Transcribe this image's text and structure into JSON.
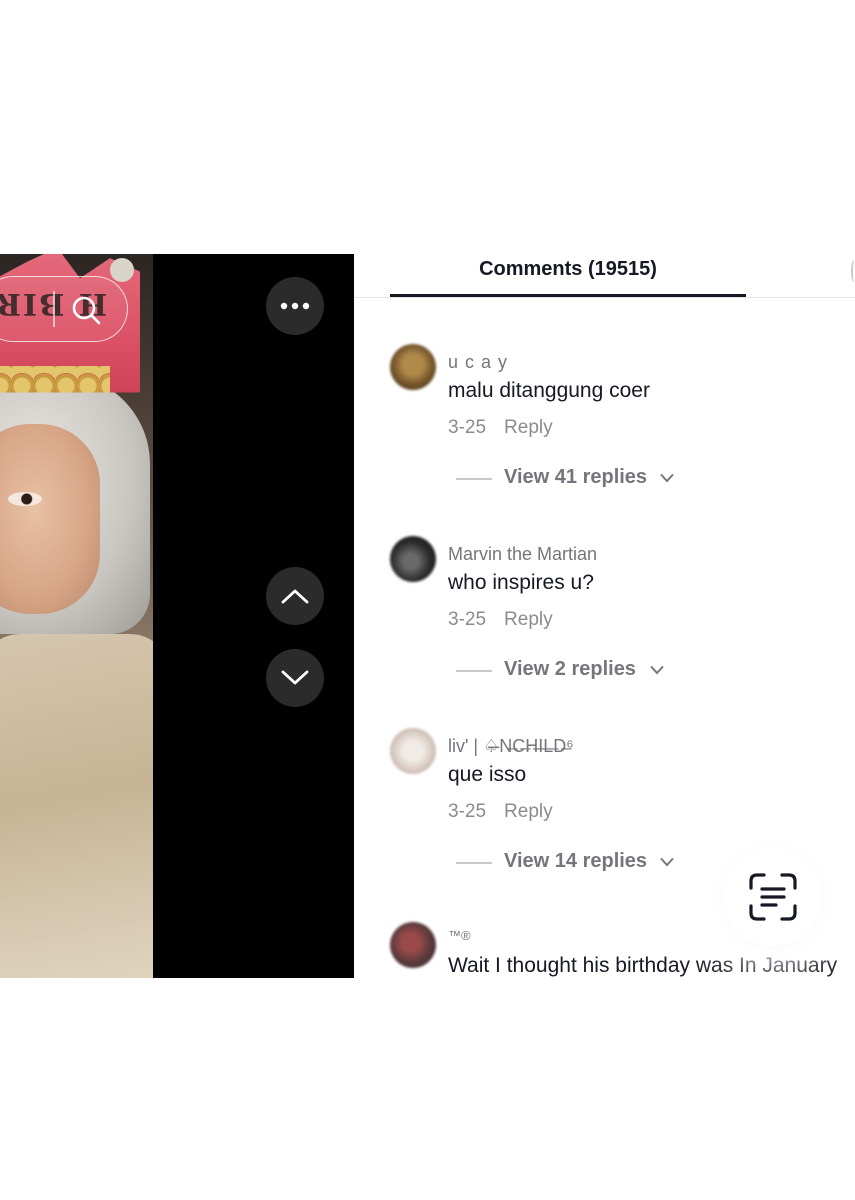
{
  "video": {
    "overlay_caption": "H BIR",
    "buttons": {
      "more": "more-icon",
      "previous": "chevron-up-icon",
      "next": "chevron-down-icon",
      "search": "search-icon"
    }
  },
  "comments_panel": {
    "tab_title": "Comments (19515)",
    "comments": [
      {
        "username": "u c a y",
        "text": "malu ditanggung coer",
        "date": "3-25",
        "reply_label": "Reply",
        "view_replies": "View 41 replies"
      },
      {
        "username": "Marvin the Martian",
        "text": "who inspires u?",
        "date": "3-25",
        "reply_label": "Reply",
        "view_replies": "View 2 replies"
      },
      {
        "username": "liv' | ♤̶N̶C̶H̶I̶L̶D̶⁶",
        "text": "que isso",
        "date": "3-25",
        "reply_label": "Reply",
        "view_replies": "View 14 replies"
      },
      {
        "username": "™®",
        "text": "Wait I thought his birthday was In January",
        "date": "",
        "reply_label": "",
        "view_replies": ""
      }
    ],
    "scan_button": "scan-text-icon"
  },
  "colors": {
    "text_primary": "#161823",
    "text_secondary": "#75767c",
    "video_background": "#000000",
    "button_background": "#2b2b2b"
  }
}
